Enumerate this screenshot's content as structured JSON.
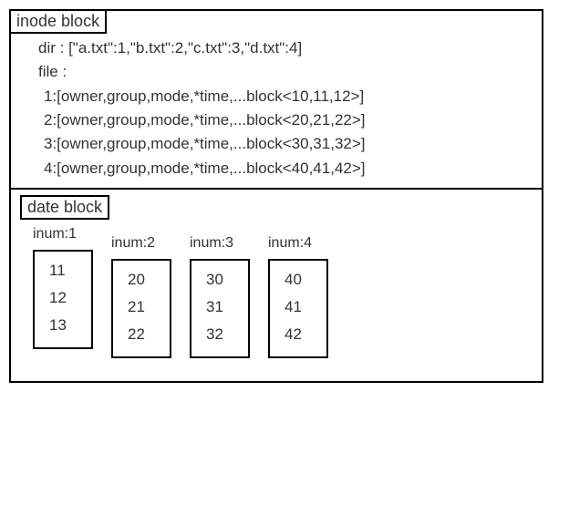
{
  "top": {
    "title": "inode block",
    "dir_label": "dir   :  ",
    "dir_value": "[\"a.txt\":1,\"b.txt\":2,\"c.txt\":3,\"d.txt\":4]",
    "file_label": "file  :",
    "files": [
      "1:[owner,group,mode,*time,...block<10,11,12>]",
      "2:[owner,group,mode,*time,...block<20,21,22>]",
      "3:[owner,group,mode,*time,...block<30,31,32>]",
      "4:[owner,group,mode,*time,...block<40,41,42>]"
    ]
  },
  "bottom": {
    "title": "date block",
    "inums": [
      {
        "label": "inum:1",
        "values": [
          "11",
          "12",
          "13"
        ]
      },
      {
        "label": "inum:2",
        "values": [
          "20",
          "21",
          "22"
        ]
      },
      {
        "label": "inum:3",
        "values": [
          "30",
          "31",
          "32"
        ]
      },
      {
        "label": "inum:4",
        "values": [
          "40",
          "41",
          "42"
        ]
      }
    ]
  }
}
